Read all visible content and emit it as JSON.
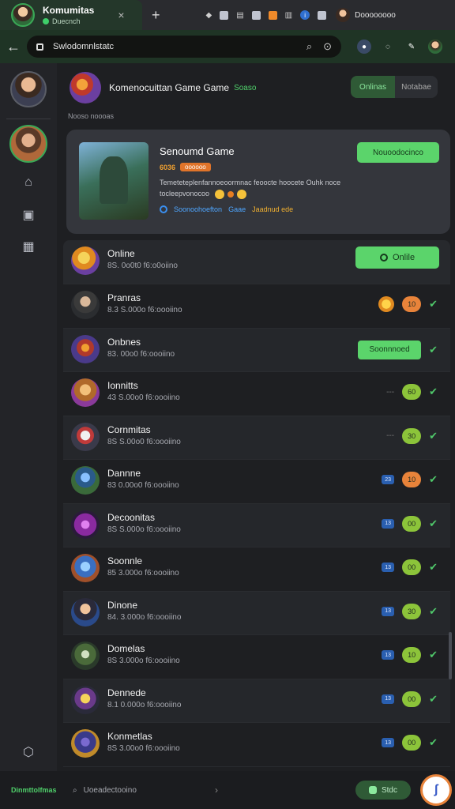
{
  "tabbar": {
    "active_title": "Komumitas",
    "active_sub": "Duecnch",
    "close": "×",
    "new_tab": "+",
    "icons": [
      "ticket-icon",
      "grid-icon",
      "label-icon",
      "box-icon",
      "orange-icon",
      "info-icon"
    ],
    "user_label": "Doooooooo"
  },
  "address": {
    "back": "←",
    "url": "Swlodomnlstatc",
    "search_icon": "⌕",
    "reload_icon": "⊙"
  },
  "header": {
    "title": "Komenocuittan Game Game",
    "tag": "Soaso",
    "switch_on": "Onlinas",
    "switch_off": "Notabae"
  },
  "section_label": "Nooso noooas",
  "featured": {
    "title": "Senoumd Game",
    "score": "6036",
    "pill": "oooooo",
    "description": "Temeteteplenfannoeoormnac feoocte hoocete Ouhk noce tocleepvonocoo",
    "link1": "Soonoohoefton",
    "link2": "Gaae",
    "link3": "Jaadnud ede",
    "button": "Nouoodocinco"
  },
  "rows": [
    {
      "name": "Online",
      "sub": "8S. 0o0t0 f6:o0oiino",
      "right": "online-button",
      "button": "Onlile"
    },
    {
      "name": "Pranras",
      "sub": "8.3 S.000o f6:oooiino",
      "right": "star",
      "count": "10",
      "count_color": "orange"
    },
    {
      "name": "Onbnes",
      "sub": "83. 00o0 f6:oooiino",
      "right": "button",
      "button": "Soonnnoed"
    },
    {
      "name": "Ionnitts",
      "sub": "43 S.00o0 f6:oooiino",
      "right": "dashes",
      "count": "60",
      "count_color": "green"
    },
    {
      "name": "Cornmitas",
      "sub": "8S S.00o0 f6:oooiino",
      "right": "dashes",
      "count": "30",
      "count_color": "green"
    },
    {
      "name": "Dannne",
      "sub": "83 0.00o0 f6:oooiino",
      "right": "badge",
      "badge": "23",
      "count": "10",
      "count_color": "orange"
    },
    {
      "name": "Decoonitas",
      "sub": "8S S.000o f6:oooiino",
      "right": "badge",
      "badge": "13",
      "count": "00",
      "count_color": "green"
    },
    {
      "name": "Soonnle",
      "sub": "85 3.000o f6:oooiino",
      "right": "badge",
      "badge": "13",
      "count": "00",
      "count_color": "green"
    },
    {
      "name": "Dinone",
      "sub": "84. 3.000o f6:oooiino",
      "right": "badge",
      "badge": "13",
      "count": "30",
      "count_color": "green"
    },
    {
      "name": "Domelas",
      "sub": "8S 3.000o f6:oooiino",
      "right": "badge",
      "badge": "13",
      "count": "10",
      "count_color": "green"
    },
    {
      "name": "Dennede",
      "sub": "8.1 0.000o f6:oooiino",
      "right": "badge",
      "badge": "13",
      "count": "00",
      "count_color": "green"
    },
    {
      "name": "Konmetlas",
      "sub": "8S 3.00o0 f6:oooiino",
      "right": "badge",
      "badge": "13",
      "count": "00",
      "count_color": "green"
    }
  ],
  "bottom": {
    "label": "Dinmttolfmas",
    "search_placeholder": "Uoeadectooino",
    "chevron": "›",
    "pill": "Stdc",
    "app_icon": "ʃ"
  },
  "colors": {
    "accent": "#5bd46b",
    "bg": "#1e1f22",
    "card": "#34363c",
    "orange": "#e8833a"
  }
}
